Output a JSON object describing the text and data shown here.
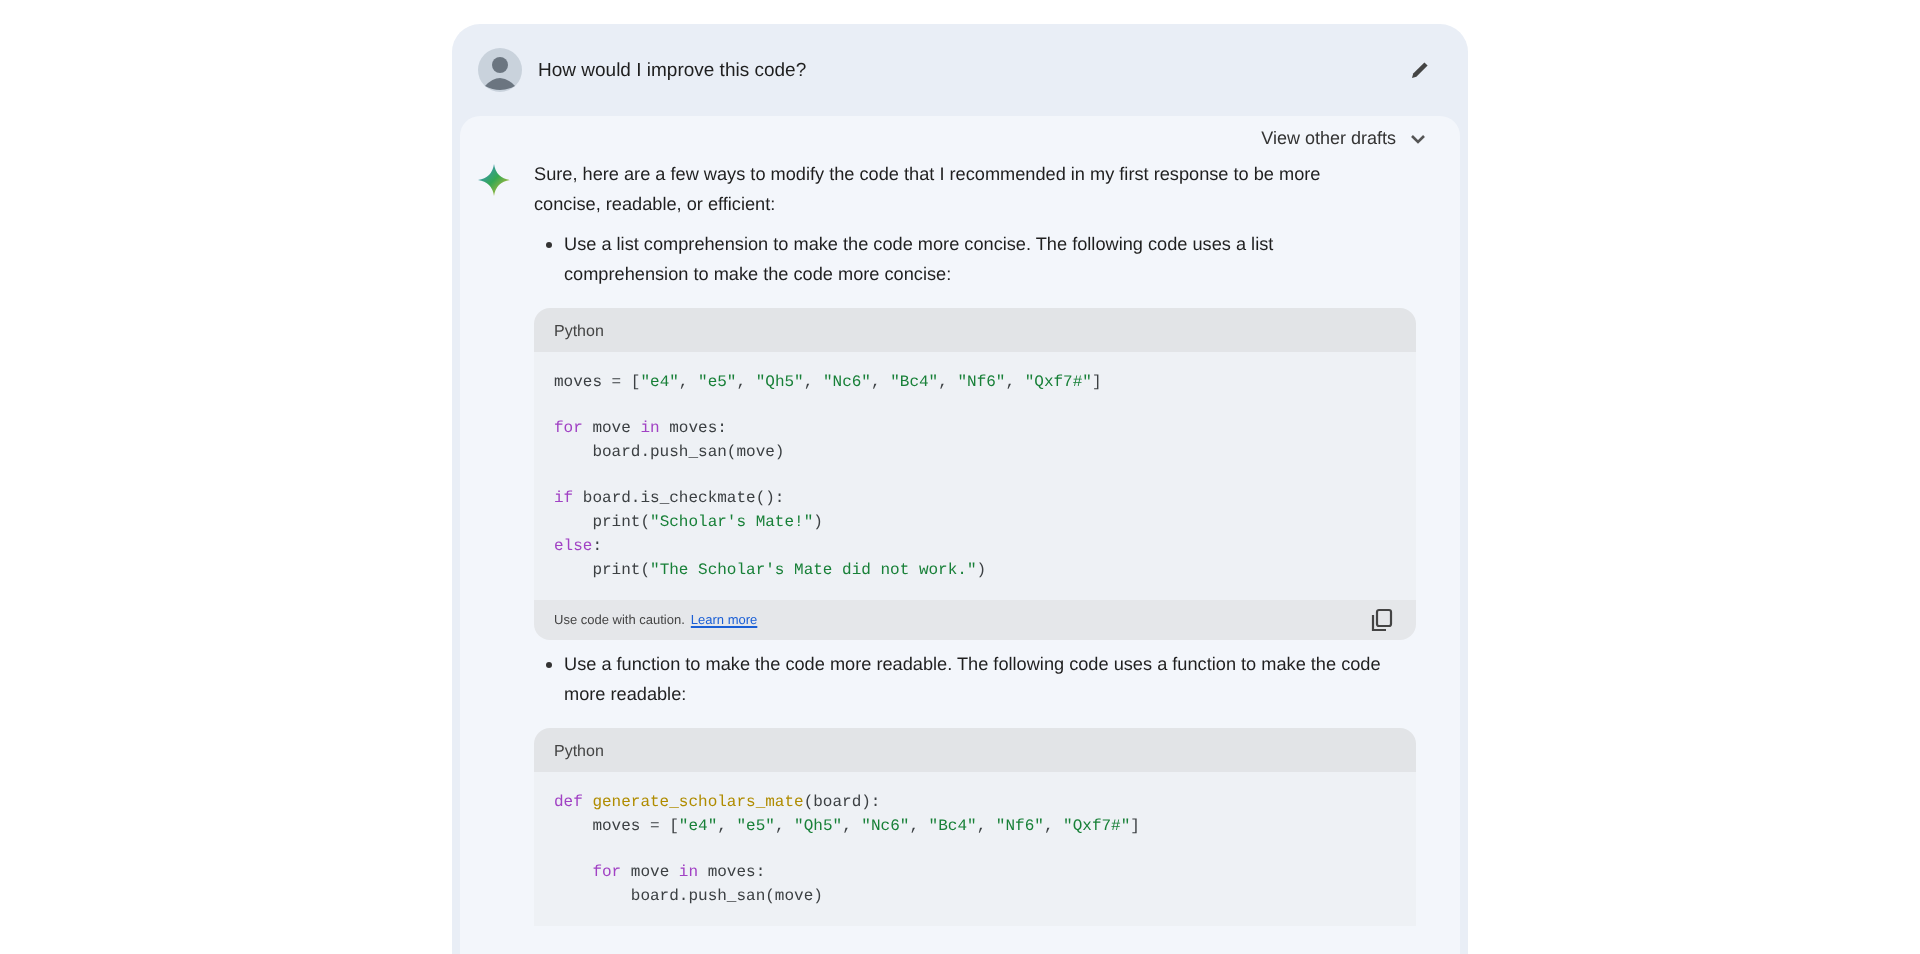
{
  "prompt": {
    "text": "How would I improve this code?"
  },
  "drafts": {
    "label": "View other drafts",
    "expanded": false
  },
  "response": {
    "intro": "Sure, here are a few ways to modify the code that I recommended in my first response to be more concise, readable, or efficient:",
    "sections": [
      {
        "bullet": "Use a list comprehension to make the code more concise. The following code uses a list comprehension to make the code more concise:",
        "code": {
          "language": "Python",
          "groups": [
            [
              [
                {
                  "text": "moves = [",
                  "kind": "plain"
                },
                {
                  "text": "\"e4\"",
                  "kind": "string"
                },
                {
                  "text": ", ",
                  "kind": "plain"
                },
                {
                  "text": "\"e5\"",
                  "kind": "string"
                },
                {
                  "text": ", ",
                  "kind": "plain"
                },
                {
                  "text": "\"Qh5\"",
                  "kind": "string"
                },
                {
                  "text": ", ",
                  "kind": "plain"
                },
                {
                  "text": "\"Nc6\"",
                  "kind": "string"
                },
                {
                  "text": ", ",
                  "kind": "plain"
                },
                {
                  "text": "\"Bc4\"",
                  "kind": "string"
                },
                {
                  "text": ", ",
                  "kind": "plain"
                },
                {
                  "text": "\"Nf6\"",
                  "kind": "string"
                },
                {
                  "text": ", ",
                  "kind": "plain"
                },
                {
                  "text": "\"Qxf7#\"",
                  "kind": "string"
                },
                {
                  "text": "]",
                  "kind": "plain"
                }
              ]
            ],
            [
              [
                {
                  "text": "for",
                  "kind": "keyword"
                },
                {
                  "text": " move ",
                  "kind": "plain"
                },
                {
                  "text": "in",
                  "kind": "keyword"
                },
                {
                  "text": " moves:",
                  "kind": "plain"
                }
              ],
              [
                {
                  "text": "    board.push_san(move)",
                  "kind": "plain"
                }
              ]
            ],
            [
              [
                {
                  "text": "if",
                  "kind": "keyword"
                },
                {
                  "text": " board.is_checkmate():",
                  "kind": "plain"
                }
              ],
              [
                {
                  "text": "    print(",
                  "kind": "plain"
                },
                {
                  "text": "\"Scholar's Mate!\"",
                  "kind": "string"
                },
                {
                  "text": ")",
                  "kind": "plain"
                }
              ],
              [
                {
                  "text": "else",
                  "kind": "keyword"
                },
                {
                  "text": ":",
                  "kind": "plain"
                }
              ],
              [
                {
                  "text": "    print(",
                  "kind": "plain"
                },
                {
                  "text": "\"The Scholar's Mate did not work.\"",
                  "kind": "string"
                },
                {
                  "text": ")",
                  "kind": "plain"
                }
              ]
            ]
          ],
          "footer": {
            "note": "Use code with caution.",
            "link": "Learn more"
          }
        }
      },
      {
        "bullet": "Use a function to make the code more readable. The following code uses a function to make the code more readable:",
        "code": {
          "language": "Python",
          "groups": [
            [
              [
                {
                  "text": "def ",
                  "kind": "keyword"
                },
                {
                  "text": "generate_scholars_mate",
                  "kind": "function"
                },
                {
                  "text": "(board):",
                  "kind": "plain"
                }
              ],
              [
                {
                  "text": "    moves = [",
                  "kind": "plain"
                },
                {
                  "text": "\"e4\"",
                  "kind": "string"
                },
                {
                  "text": ", ",
                  "kind": "plain"
                },
                {
                  "text": "\"e5\"",
                  "kind": "string"
                },
                {
                  "text": ", ",
                  "kind": "plain"
                },
                {
                  "text": "\"Qh5\"",
                  "kind": "string"
                },
                {
                  "text": ", ",
                  "kind": "plain"
                },
                {
                  "text": "\"Nc6\"",
                  "kind": "string"
                },
                {
                  "text": ", ",
                  "kind": "plain"
                },
                {
                  "text": "\"Bc4\"",
                  "kind": "string"
                },
                {
                  "text": ", ",
                  "kind": "plain"
                },
                {
                  "text": "\"Nf6\"",
                  "kind": "string"
                },
                {
                  "text": ", ",
                  "kind": "plain"
                },
                {
                  "text": "\"Qxf7#\"",
                  "kind": "string"
                },
                {
                  "text": "]",
                  "kind": "plain"
                }
              ]
            ],
            [
              [
                {
                  "text": "    for",
                  "kind": "keyword"
                },
                {
                  "text": " move ",
                  "kind": "plain"
                },
                {
                  "text": "in",
                  "kind": "keyword"
                },
                {
                  "text": " moves:",
                  "kind": "plain"
                }
              ],
              [
                {
                  "text": "        board.push_san(move)",
                  "kind": "plain"
                }
              ]
            ]
          ]
        }
      }
    ]
  }
}
